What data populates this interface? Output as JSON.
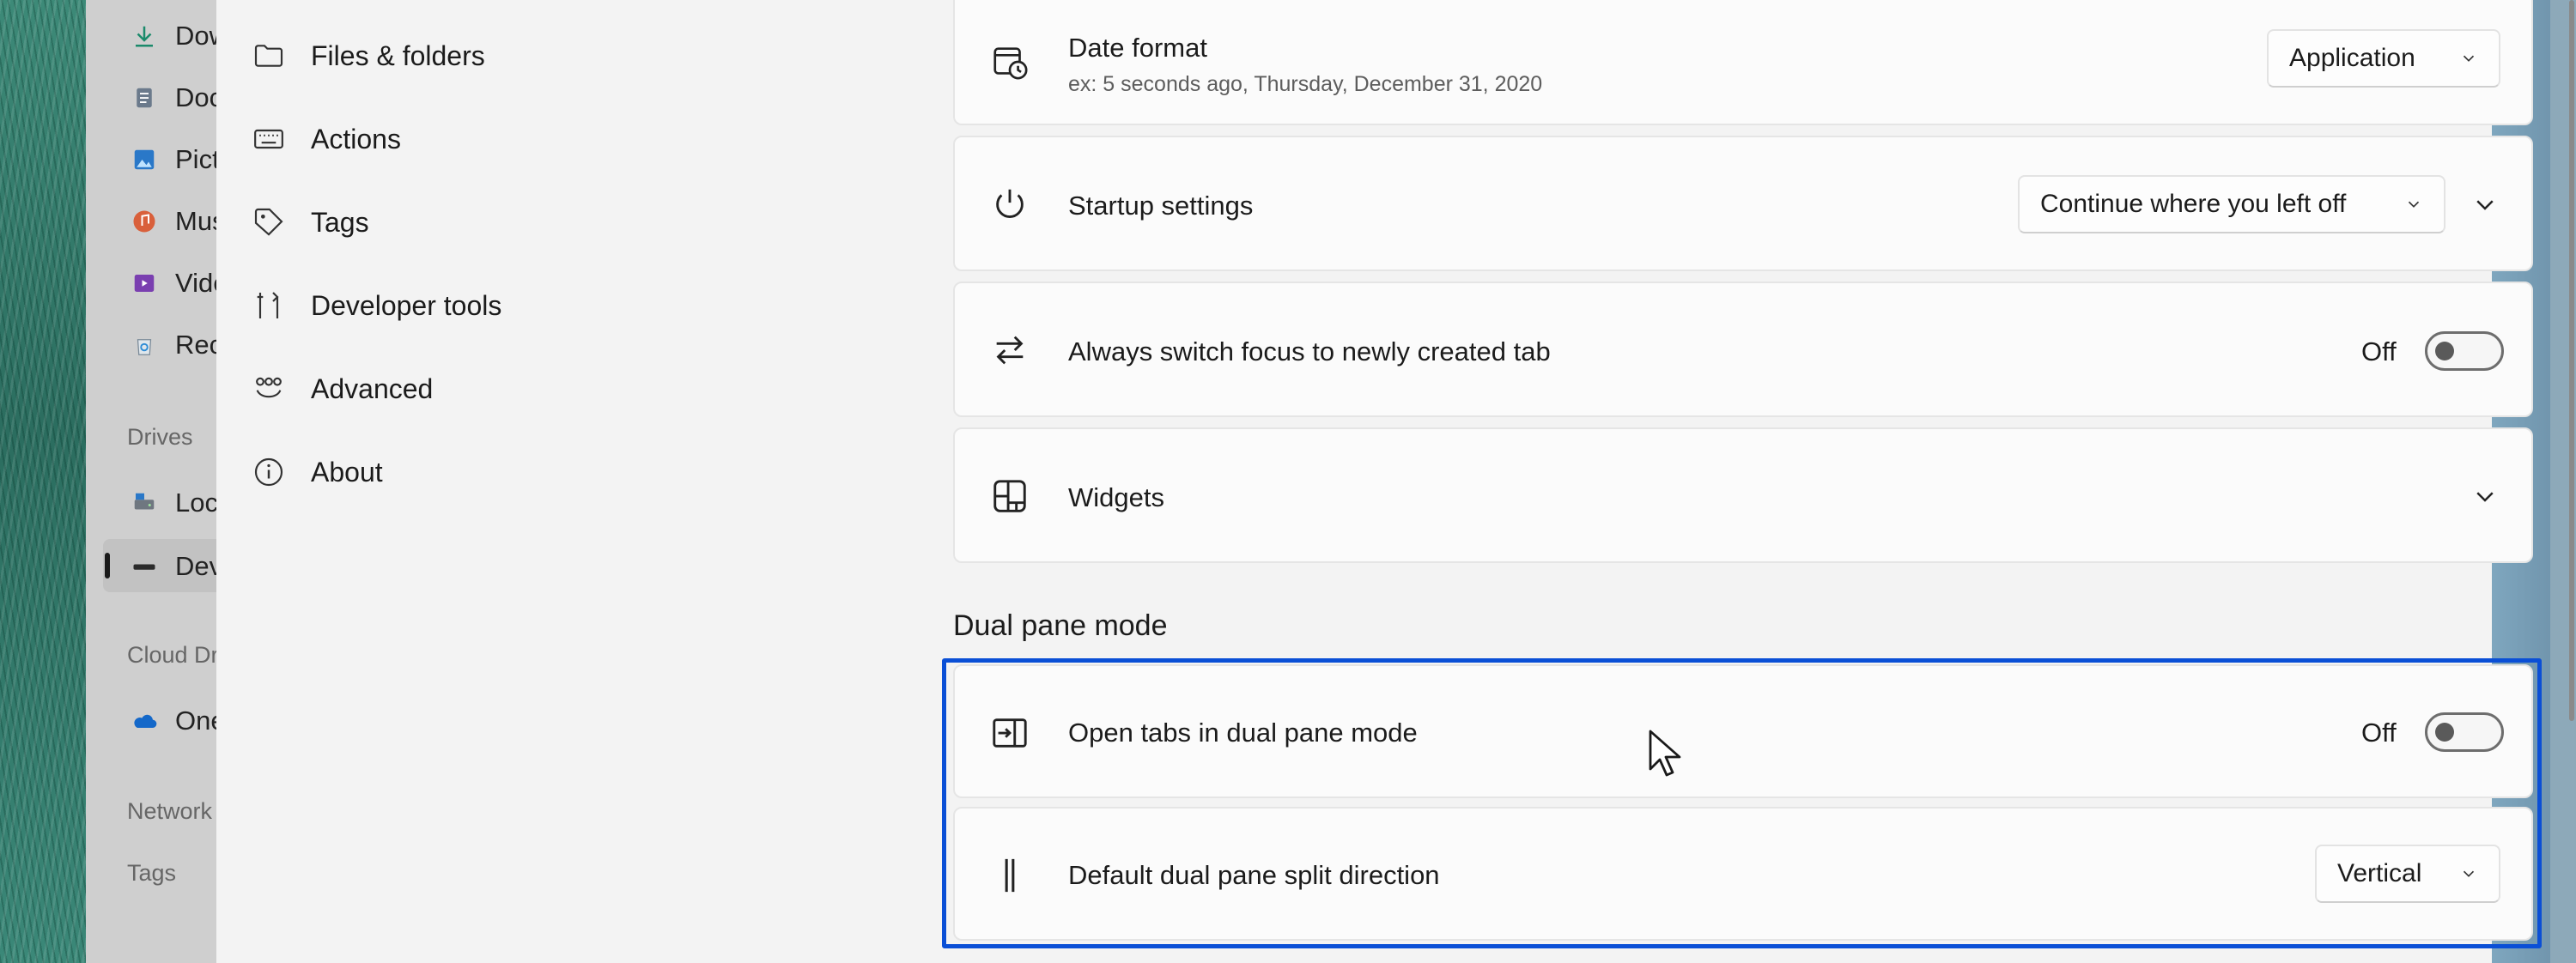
{
  "files_sidebar": {
    "items": [
      {
        "label": "Downloads",
        "icon": "download-icon"
      },
      {
        "label": "Documents",
        "icon": "document-icon"
      },
      {
        "label": "Pictures",
        "icon": "pictures-icon"
      },
      {
        "label": "Music",
        "icon": "music-icon"
      },
      {
        "label": "Videos",
        "icon": "videos-icon"
      },
      {
        "label": "Recycle Bin",
        "icon": "recycle-bin-icon"
      }
    ],
    "drives_header": "Drives",
    "drives": [
      {
        "label": "Local Disk",
        "icon": "local-disk-icon"
      },
      {
        "label": "Dev Drive",
        "icon": "drive-icon"
      }
    ],
    "cloud_header": "Cloud Drives",
    "cloud": [
      {
        "label": "OneDrive",
        "icon": "onedrive-icon"
      }
    ],
    "network_header": "Network",
    "tags_header": "Tags"
  },
  "settings_nav": {
    "items": [
      {
        "label": "Files & folders",
        "icon": "folder-icon"
      },
      {
        "label": "Actions",
        "icon": "keyboard-icon"
      },
      {
        "label": "Tags",
        "icon": "tag-icon"
      },
      {
        "label": "Developer tools",
        "icon": "developer-tools-icon"
      },
      {
        "label": "Advanced",
        "icon": "advanced-icon"
      },
      {
        "label": "About",
        "icon": "info-icon"
      }
    ]
  },
  "settings": {
    "date_format": {
      "title": "Date format",
      "subtitle": "ex: 5 seconds ago, Thursday, December 31, 2020",
      "value": "Application",
      "icon": "calendar-clock-icon"
    },
    "startup": {
      "title": "Startup settings",
      "value": "Continue where you left off",
      "icon": "power-icon"
    },
    "switch_focus": {
      "title": "Always switch focus to newly created tab",
      "toggle_label": "Off",
      "toggle_on": false,
      "icon": "switch-arrows-icon"
    },
    "widgets": {
      "title": "Widgets",
      "icon": "widgets-icon"
    },
    "dual_pane_header": "Dual pane mode",
    "open_dual_pane": {
      "title": "Open tabs in dual pane mode",
      "toggle_label": "Off",
      "toggle_on": false,
      "icon": "dual-pane-icon"
    },
    "split_direction": {
      "title": "Default dual pane split direction",
      "value": "Vertical",
      "icon": "vertical-split-icon"
    }
  },
  "colors": {
    "highlight": "#0a4fd6",
    "card_bg": "#fbfbfb",
    "dialog_bg": "#f3f3f3"
  }
}
